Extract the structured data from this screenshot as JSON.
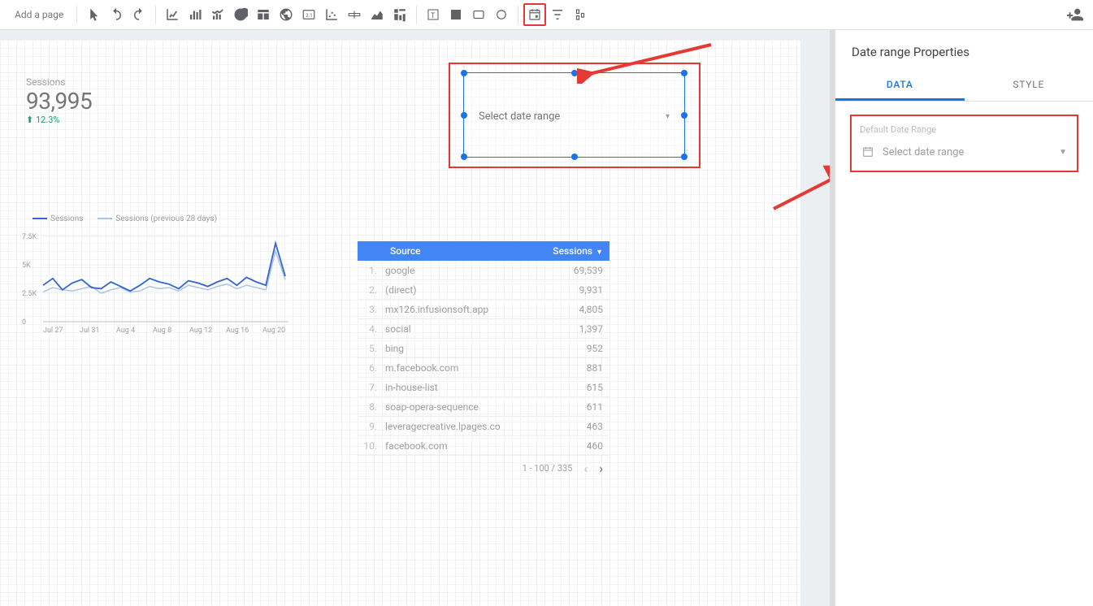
{
  "toolbar": {
    "add_page": "Add a page"
  },
  "scorecard": {
    "label": "Sessions",
    "value": "93,995",
    "delta": "⬆ 12.3%"
  },
  "date_range_control": {
    "placeholder": "Select date range"
  },
  "chart_data": {
    "type": "line",
    "title": "",
    "xlabel": "",
    "ylabel": "",
    "ylim": [
      0,
      7500
    ],
    "yticks": [
      "0",
      "2.5K",
      "5K",
      "7.5K"
    ],
    "categories": [
      "Jul 27",
      "Jul 31",
      "Aug 4",
      "Aug 8",
      "Aug 12",
      "Aug 16",
      "Aug 20"
    ],
    "series": [
      {
        "name": "Sessions",
        "values": [
          3200,
          3800,
          2800,
          3400,
          3700,
          3000,
          2900,
          3500,
          3100,
          2700,
          3200,
          3800,
          3500,
          3300,
          2900,
          3600,
          3400,
          3100,
          3500,
          3800,
          3200,
          3900,
          3500,
          3200,
          6900,
          4000
        ]
      },
      {
        "name": "Sessions (previous 28 days)",
        "values": [
          2600,
          3000,
          2800,
          2700,
          2900,
          3100,
          2500,
          2800,
          3000,
          2600,
          2700,
          3100,
          2900,
          3000,
          2700,
          3200,
          3000,
          2800,
          3100,
          3300,
          2900,
          3200,
          3000,
          2800,
          6200,
          3700
        ]
      }
    ]
  },
  "table": {
    "header_source": "Source",
    "header_sessions": "Sessions",
    "rows": [
      {
        "idx": "1.",
        "source": "google",
        "sessions": "69,539"
      },
      {
        "idx": "2.",
        "source": "(direct)",
        "sessions": "9,931"
      },
      {
        "idx": "3.",
        "source": "mx126.infusionsoft.app",
        "sessions": "4,805"
      },
      {
        "idx": "4.",
        "source": "social",
        "sessions": "1,397"
      },
      {
        "idx": "5.",
        "source": "bing",
        "sessions": "952"
      },
      {
        "idx": "6.",
        "source": "m.facebook.com",
        "sessions": "881"
      },
      {
        "idx": "7.",
        "source": "in-house-list",
        "sessions": "615"
      },
      {
        "idx": "8.",
        "source": "soap-opera-sequence",
        "sessions": "611"
      },
      {
        "idx": "9.",
        "source": "leveragecreative.lpages.co",
        "sessions": "463"
      },
      {
        "idx": "10.",
        "source": "facebook.com",
        "sessions": "460"
      }
    ],
    "pager": "1 - 100 / 335"
  },
  "panel": {
    "title": "Date range Properties",
    "tab_data": "DATA",
    "tab_style": "STYLE",
    "default_range_label": "Default Date Range",
    "selector_text": "Select date range"
  }
}
